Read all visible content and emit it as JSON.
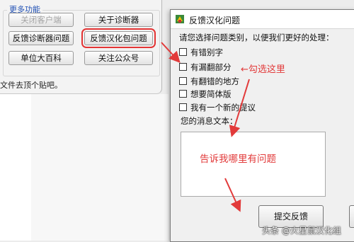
{
  "background_window": {
    "group_title": "更多功能",
    "buttons": {
      "close_client": "关闭客户端",
      "about_diagnostics": "关于诊断器",
      "feedback_diagnostics": "反馈诊断器问题",
      "feedback_localization": "反馈汉化包问题",
      "unit_encyclopedia": "单位大百科",
      "follow_official": "关注公众号"
    },
    "footnote": "文件去顶个贴吧。"
  },
  "dialog": {
    "title": "反馈汉化问题",
    "prompt": "请您选择问题类别，以便我们更好的处理：",
    "options": [
      "有错别字",
      "有漏翻部分",
      "有翻错的地方",
      "想要简体版",
      "我有一个新的提议"
    ],
    "message_label": "您的消息文本：",
    "message_placeholder": "告诉我哪里有问题",
    "submit_label": "提交反馈"
  },
  "annotations": {
    "callout": "←勾选这里",
    "accent_color": "#e23a3a"
  },
  "watermark": "头条 @火星鼠汉化组"
}
